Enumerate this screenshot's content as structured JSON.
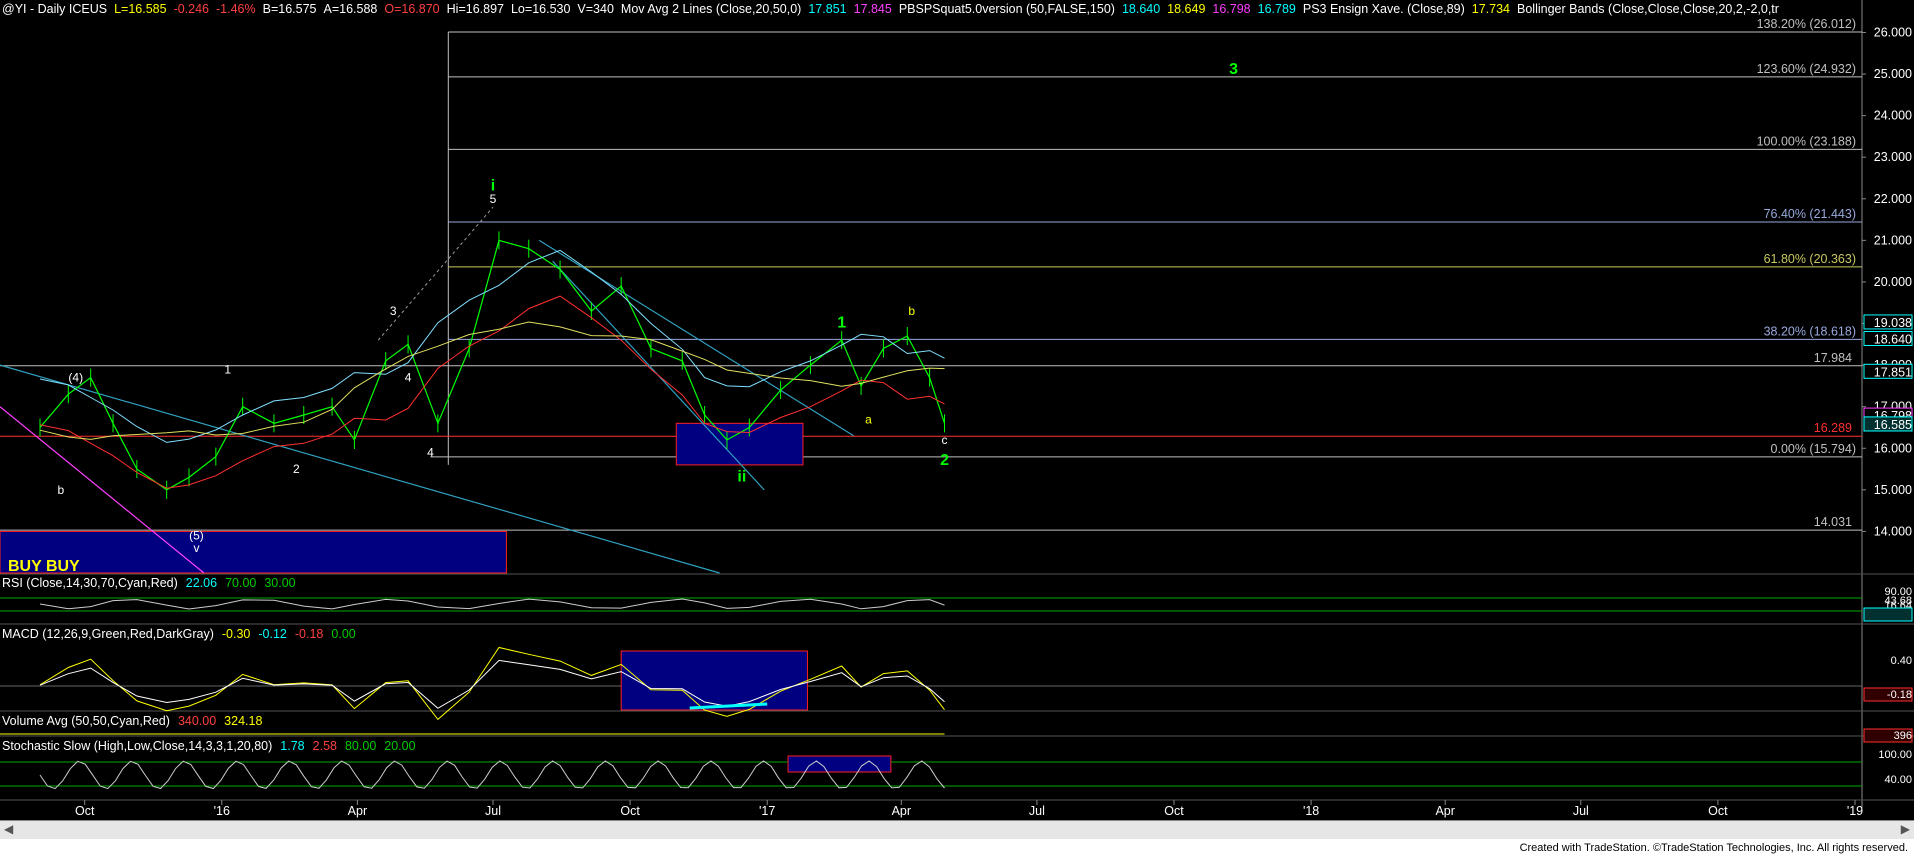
{
  "header": {
    "symbol": "@YI - Daily  ICEUS",
    "last": "L=16.585",
    "change": "-0.246",
    "change_pct": "-1.46%",
    "bid": "B=16.575",
    "ask": "A=16.588",
    "open": "O=16.870",
    "high": "Hi=16.897",
    "low": "Lo=16.530",
    "volume": "V=340",
    "mavg_label": "Mov Avg 2 Lines (Close,20,50,0)",
    "mavg_v1": "17.851",
    "mavg_v2": "17.845",
    "pbs_label": "PBSPSquat5.0version (50,FALSE,150)",
    "pbs_v1": "18.640",
    "pbs_v2": "18.649",
    "pbs_v3": "16.798",
    "pbs_v4": "16.789",
    "ens_label": "PS3 Ensign Xave. (Close,89)",
    "ens_v": "17.734",
    "bb_label": "Bollinger Bands (Close,Close,Close,20,2,-2,0,tr"
  },
  "rsi": {
    "label": "RSI (Close,14,30,70,Cyan,Red)",
    "v1": "22.06",
    "v2": "70.00",
    "v3": "30.00"
  },
  "macd": {
    "label": "MACD (12,26,9,Green,Red,DarkGray)",
    "v1": "-0.30",
    "v2": "-0.12",
    "v3": "-0.18",
    "v4": "0.00"
  },
  "volume": {
    "label": "Volume Avg (50,50,Cyan,Red)",
    "v1": "340.00",
    "v2": "324.18"
  },
  "stoch": {
    "label": "Stochastic Slow (High,Low,Close,14,3,3,1,20,80)",
    "v1": "1.78",
    "v2": "2.58",
    "v3": "80.00",
    "v4": "20.00"
  },
  "chart_data": {
    "type": "line",
    "title": "@YI - Daily ICEUS",
    "y_range": [
      13.0,
      26.3
    ],
    "y_ticks": [
      "14.000",
      "15.000",
      "16.000",
      "17.000",
      "18.000",
      "19.000",
      "20.000",
      "21.000",
      "22.000",
      "23.000",
      "24.000",
      "25.000",
      "26.000"
    ],
    "x_ticks": [
      "Oct",
      "'16",
      "Apr",
      "Jul",
      "Oct",
      "'17",
      "Apr",
      "Jul",
      "Oct",
      "'18",
      "Apr",
      "Jul",
      "Oct",
      "'19"
    ],
    "fib_levels": [
      {
        "label": "138.20% (26.012)",
        "value": 26.012
      },
      {
        "label": "123.60% (24.932)",
        "value": 24.932
      },
      {
        "label": "100.00% (23.188)",
        "value": 23.188
      },
      {
        "label": "76.40% (21.443)",
        "value": 21.443
      },
      {
        "label": "61.80% (20.363)",
        "value": 20.363
      },
      {
        "label": "38.20% (18.618)",
        "value": 18.618
      },
      {
        "label": "0.00% (15.794)",
        "value": 15.794
      }
    ],
    "horizontal_lines": [
      {
        "label": "17.984",
        "value": 17.984
      },
      {
        "label": "16.289",
        "value": 16.289
      },
      {
        "label": "14.031",
        "value": 14.031
      }
    ],
    "price_tags": [
      {
        "label": "19.038",
        "value": 19.038
      },
      {
        "label": "18.640",
        "value": 18.64
      },
      {
        "label": "17.851",
        "value": 17.851
      },
      {
        "label": "16.798",
        "value": 16.798
      },
      {
        "label": "16.585",
        "value": 16.585
      }
    ],
    "price_series": [
      [
        "2015-09-01",
        16.5
      ],
      [
        "2015-09-20",
        17.3
      ],
      [
        "2015-10-05",
        17.7
      ],
      [
        "2015-10-20",
        16.6
      ],
      [
        "2015-11-05",
        15.5
      ],
      [
        "2015-11-25",
        15.0
      ],
      [
        "2015-12-10",
        15.3
      ],
      [
        "2015-12-28",
        15.8
      ],
      [
        "2016-01-15",
        17.0
      ],
      [
        "2016-02-05",
        16.6
      ],
      [
        "2016-02-25",
        16.8
      ],
      [
        "2016-03-15",
        17.0
      ],
      [
        "2016-03-30",
        16.2
      ],
      [
        "2016-04-20",
        18.1
      ],
      [
        "2016-05-05",
        18.5
      ],
      [
        "2016-05-25",
        16.6
      ],
      [
        "2016-06-15",
        18.4
      ],
      [
        "2016-07-05",
        21.0
      ],
      [
        "2016-07-25",
        20.8
      ],
      [
        "2016-08-15",
        20.3
      ],
      [
        "2016-09-05",
        19.3
      ],
      [
        "2016-09-25",
        19.9
      ],
      [
        "2016-10-15",
        18.4
      ],
      [
        "2016-11-05",
        18.1
      ],
      [
        "2016-11-20",
        16.8
      ],
      [
        "2016-12-05",
        16.2
      ],
      [
        "2016-12-20",
        16.5
      ],
      [
        "2017-01-10",
        17.4
      ],
      [
        "2017-01-30",
        18.0
      ],
      [
        "2017-02-20",
        18.6
      ],
      [
        "2017-03-05",
        17.5
      ],
      [
        "2017-03-20",
        18.4
      ],
      [
        "2017-04-05",
        18.7
      ],
      [
        "2017-04-20",
        17.7
      ],
      [
        "2017-04-30",
        16.6
      ]
    ],
    "wave_labels": [
      {
        "text": "i",
        "x": "2016-07-01",
        "y": 22.2,
        "color": "#00ff00"
      },
      {
        "text": "5",
        "x": "2016-07-01",
        "y": 21.9,
        "color": "#ffffff"
      },
      {
        "text": "3",
        "x": "2016-04-25",
        "y": 19.2,
        "color": "#ffffff"
      },
      {
        "text": "1",
        "x": "2016-01-05",
        "y": 17.8,
        "color": "#ffffff"
      },
      {
        "text": "2",
        "x": "2016-02-20",
        "y": 15.4,
        "color": "#ffffff"
      },
      {
        "text": "4",
        "x": "2016-05-20",
        "y": 15.8,
        "color": "#ffffff"
      },
      {
        "text": "4",
        "x": "2016-05-05",
        "y": 17.6,
        "color": "#ffffff"
      },
      {
        "text": "(4)",
        "x": "2015-09-25",
        "y": 17.6,
        "color": "#ffffff"
      },
      {
        "text": "b",
        "x": "2015-09-15",
        "y": 14.9,
        "color": "#ffffff"
      },
      {
        "text": "(5)",
        "x": "2015-12-15",
        "y": 13.8,
        "color": "#ffffff"
      },
      {
        "text": "v",
        "x": "2015-12-15",
        "y": 13.5,
        "color": "#ffffff"
      },
      {
        "text": "ii",
        "x": "2016-12-15",
        "y": 15.2,
        "color": "#00ff00"
      },
      {
        "text": "1",
        "x": "2017-02-20",
        "y": 18.9,
        "color": "#00ff00"
      },
      {
        "text": "a",
        "x": "2017-03-10",
        "y": 16.6,
        "color": "#ffff00"
      },
      {
        "text": "b",
        "x": "2017-04-08",
        "y": 19.2,
        "color": "#ffff00"
      },
      {
        "text": "c",
        "x": "2017-04-30",
        "y": 16.1,
        "color": "#ffffff"
      },
      {
        "text": "2",
        "x": "2017-04-30",
        "y": 15.6,
        "color": "#00ff00"
      },
      {
        "text": "3",
        "x": "2017-11-10",
        "y": 25.0,
        "color": "#00ff00"
      }
    ],
    "annotation_text": "BUY BUY",
    "rsi_axis": [
      "90.00",
      "43.68",
      "16.64",
      "22.06"
    ],
    "macd_axis": [
      "0.40",
      "-0.18"
    ],
    "volume_axis": [
      "396"
    ],
    "stoch_axis": [
      "100.00",
      "40.00"
    ]
  },
  "colors": {
    "background": "#000000",
    "price": "#00ff00",
    "fib": "#c0c0c0",
    "red_line": "#ff3030",
    "box_fill": "#000080",
    "box_border": "#ff2020"
  },
  "footer": "Created with TradeStation. ©TradeStation Technologies, Inc. All rights reserved."
}
